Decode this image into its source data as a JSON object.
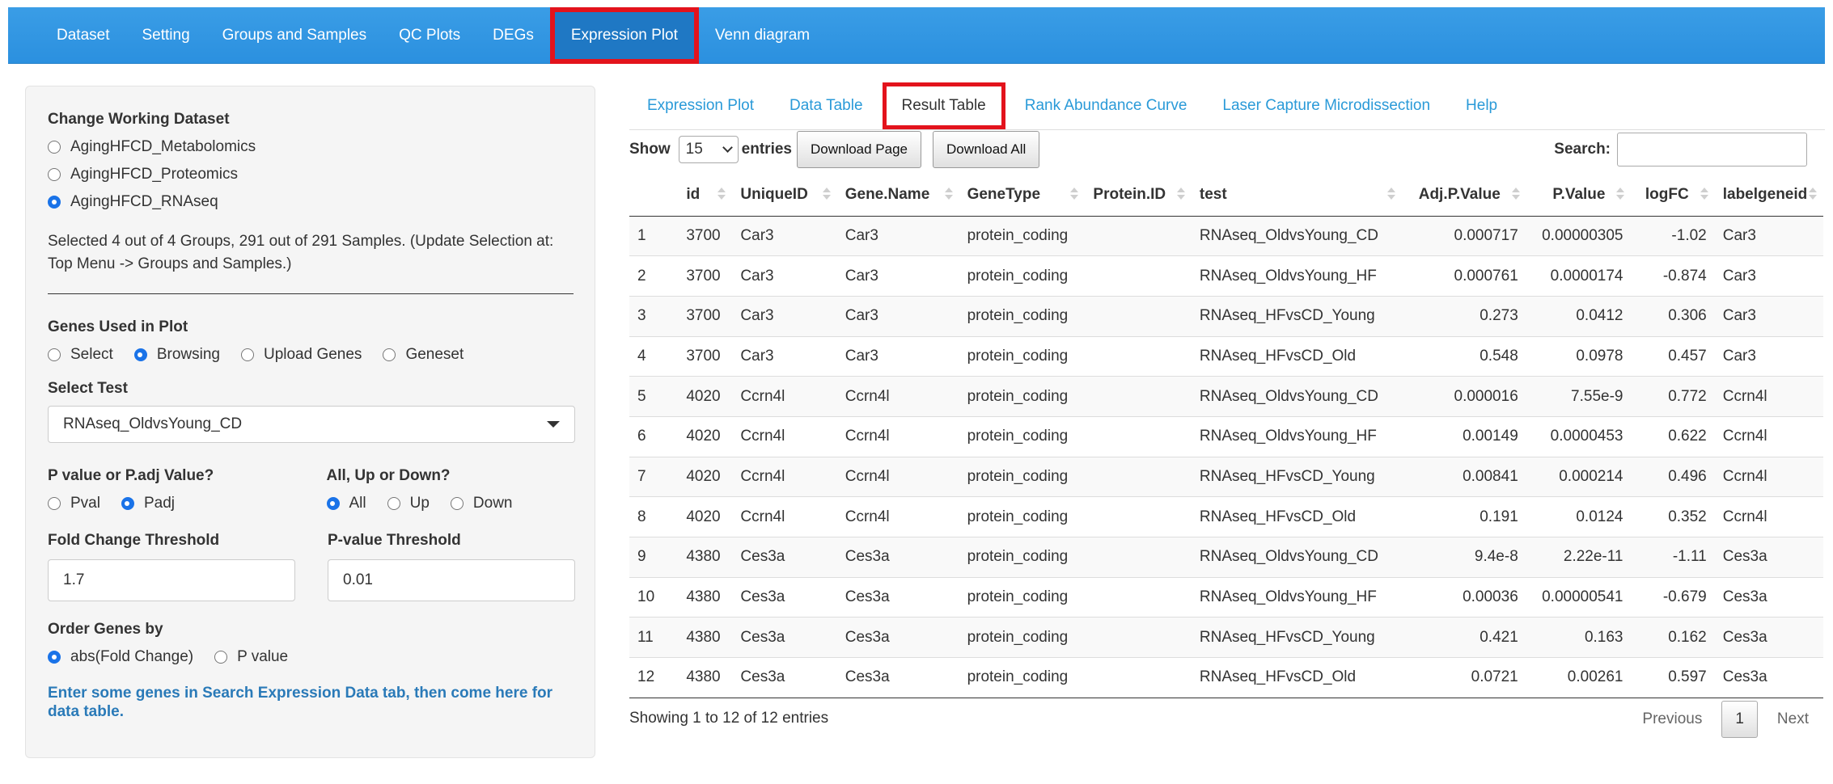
{
  "navbar": {
    "items": [
      "Dataset",
      "Setting",
      "Groups and Samples",
      "QC Plots",
      "DEGs",
      "Expression Plot",
      "Venn diagram"
    ],
    "active": "Expression Plot"
  },
  "sidebar": {
    "dataset_label": "Change Working Dataset",
    "datasets": [
      "AgingHFCD_Metabolomics",
      "AgingHFCD_Proteomics",
      "AgingHFCD_RNAseq"
    ],
    "selected_dataset": "AgingHFCD_RNAseq",
    "selection_info": "Selected 4 out of 4 Groups, 291 out of 291 Samples. (Update Selection at: Top Menu -> Groups and Samples.)",
    "genes_label": "Genes Used in Plot",
    "genes_options": [
      "Select",
      "Browsing",
      "Upload Genes",
      "Geneset"
    ],
    "genes_selected": "Browsing",
    "test_label": "Select Test",
    "test_value": "RNAseq_OldvsYoung_CD",
    "pval_label": "P value or P.adj Value?",
    "pval_options": [
      "Pval",
      "Padj"
    ],
    "pval_selected": "Padj",
    "direction_label": "All, Up or Down?",
    "direction_options": [
      "All",
      "Up",
      "Down"
    ],
    "direction_selected": "All",
    "fc_label": "Fold Change Threshold",
    "fc_value": "1.7",
    "pthresh_label": "P-value Threshold",
    "pthresh_value": "0.01",
    "order_label": "Order Genes by",
    "order_options": [
      "abs(Fold Change)",
      "P value"
    ],
    "order_selected": "abs(Fold Change)",
    "note": "Enter some genes in Search Expression Data tab, then come here for data table."
  },
  "tabs": {
    "items": [
      "Expression Plot",
      "Data Table",
      "Result Table",
      "Rank Abundance Curve",
      "Laser Capture Microdissection",
      "Help"
    ],
    "active": "Result Table"
  },
  "table_controls": {
    "show": "Show",
    "length": "15",
    "entries": "entries",
    "download_page": "Download Page",
    "download_all": "Download All",
    "search_label": "Search:"
  },
  "table": {
    "columns": [
      "",
      "id",
      "UniqueID",
      "Gene.Name",
      "GeneType",
      "Protein.ID",
      "test",
      "Adj.P.Value",
      "P.Value",
      "logFC",
      "labelgeneid"
    ],
    "rows": [
      [
        "1",
        "3700",
        "Car3",
        "Car3",
        "protein_coding",
        "",
        "RNAseq_OldvsYoung_CD",
        "0.000717",
        "0.00000305",
        "-1.02",
        "Car3"
      ],
      [
        "2",
        "3700",
        "Car3",
        "Car3",
        "protein_coding",
        "",
        "RNAseq_OldvsYoung_HF",
        "0.000761",
        "0.0000174",
        "-0.874",
        "Car3"
      ],
      [
        "3",
        "3700",
        "Car3",
        "Car3",
        "protein_coding",
        "",
        "RNAseq_HFvsCD_Young",
        "0.273",
        "0.0412",
        "0.306",
        "Car3"
      ],
      [
        "4",
        "3700",
        "Car3",
        "Car3",
        "protein_coding",
        "",
        "RNAseq_HFvsCD_Old",
        "0.548",
        "0.0978",
        "0.457",
        "Car3"
      ],
      [
        "5",
        "4020",
        "Ccrn4l",
        "Ccrn4l",
        "protein_coding",
        "",
        "RNAseq_OldvsYoung_CD",
        "0.000016",
        "7.55e-9",
        "0.772",
        "Ccrn4l"
      ],
      [
        "6",
        "4020",
        "Ccrn4l",
        "Ccrn4l",
        "protein_coding",
        "",
        "RNAseq_OldvsYoung_HF",
        "0.00149",
        "0.0000453",
        "0.622",
        "Ccrn4l"
      ],
      [
        "7",
        "4020",
        "Ccrn4l",
        "Ccrn4l",
        "protein_coding",
        "",
        "RNAseq_HFvsCD_Young",
        "0.00841",
        "0.000214",
        "0.496",
        "Ccrn4l"
      ],
      [
        "8",
        "4020",
        "Ccrn4l",
        "Ccrn4l",
        "protein_coding",
        "",
        "RNAseq_HFvsCD_Old",
        "0.191",
        "0.0124",
        "0.352",
        "Ccrn4l"
      ],
      [
        "9",
        "4380",
        "Ces3a",
        "Ces3a",
        "protein_coding",
        "",
        "RNAseq_OldvsYoung_CD",
        "9.4e-8",
        "2.22e-11",
        "-1.11",
        "Ces3a"
      ],
      [
        "10",
        "4380",
        "Ces3a",
        "Ces3a",
        "protein_coding",
        "",
        "RNAseq_OldvsYoung_HF",
        "0.00036",
        "0.00000541",
        "-0.679",
        "Ces3a"
      ],
      [
        "11",
        "4380",
        "Ces3a",
        "Ces3a",
        "protein_coding",
        "",
        "RNAseq_HFvsCD_Young",
        "0.421",
        "0.163",
        "0.162",
        "Ces3a"
      ],
      [
        "12",
        "4380",
        "Ces3a",
        "Ces3a",
        "protein_coding",
        "",
        "RNAseq_HFvsCD_Old",
        "0.0721",
        "0.00261",
        "0.597",
        "Ces3a"
      ]
    ]
  },
  "footer": {
    "info": "Showing 1 to 12 of 12 entries",
    "previous": "Previous",
    "page": "1",
    "next": "Next"
  },
  "colors": {
    "navbar": "#2b90df",
    "highlight": "#e3131c",
    "link": "#2a9ad8",
    "radio_checked": "#1a73e8"
  }
}
